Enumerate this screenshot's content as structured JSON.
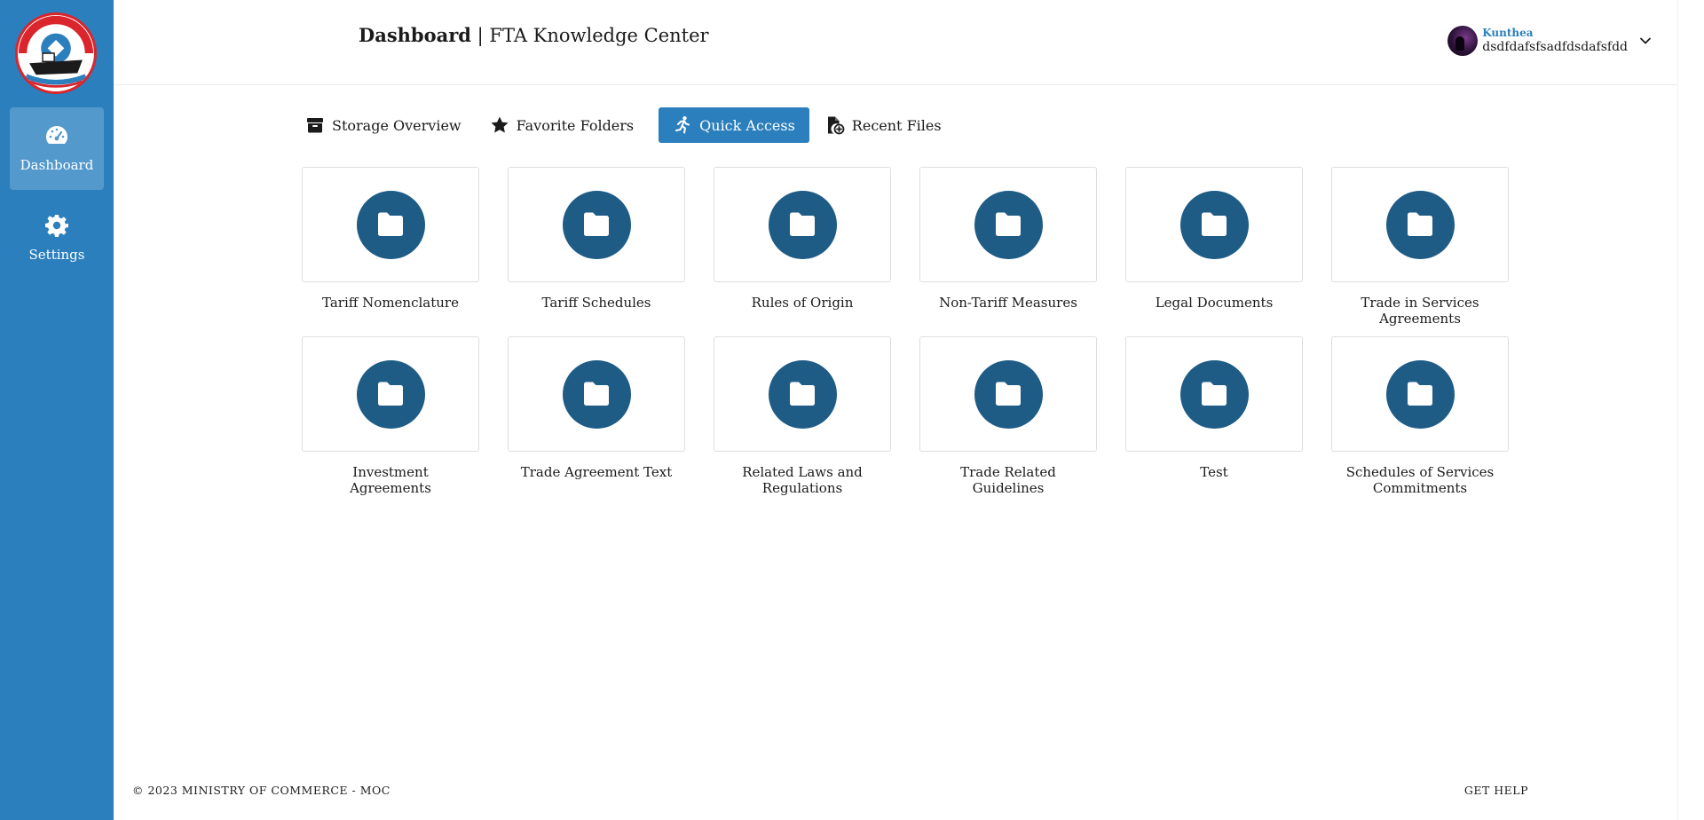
{
  "sidebar": {
    "items": [
      {
        "label": "Dashboard",
        "icon": "gauge-icon",
        "active": true
      },
      {
        "label": "Settings",
        "icon": "gear-icon",
        "active": false
      }
    ]
  },
  "header": {
    "title_strong": "Dashboard",
    "title_rest": " | FTA Knowledge Center",
    "user": {
      "name": "Kunthea",
      "sub": "dsdfdafsfsadfdsdafsfdd"
    }
  },
  "tabs": [
    {
      "label": "Storage Overview",
      "icon": "archive-box-icon",
      "active": false
    },
    {
      "label": "Favorite Folders",
      "icon": "star-icon",
      "active": false
    },
    {
      "label": "Quick Access",
      "icon": "running-person-icon",
      "active": true
    },
    {
      "label": "Recent Files",
      "icon": "file-add-icon",
      "active": false
    }
  ],
  "folders": [
    {
      "label": "Tariff Nomenclature"
    },
    {
      "label": "Tariff Schedules"
    },
    {
      "label": "Rules of Origin"
    },
    {
      "label": "Non-Tariff Measures"
    },
    {
      "label": "Legal Documents"
    },
    {
      "label": "Trade in Services Agreements"
    },
    {
      "label": "Investment Agreements"
    },
    {
      "label": "Trade Agreement Text"
    },
    {
      "label": "Related Laws and Regulations"
    },
    {
      "label": "Trade Related Guidelines"
    },
    {
      "label": "Test"
    },
    {
      "label": "Schedules of Services Commitments"
    }
  ],
  "footer": {
    "copyright": "© 2023 MINISTRY OF COMMERCE - MOC",
    "help": "GET HELP"
  },
  "colors": {
    "sidebar": "#2b7fbd",
    "sidebar_active": "#5499cc",
    "accent": "#2b7fbd",
    "folder_circle": "#1e5c86"
  }
}
